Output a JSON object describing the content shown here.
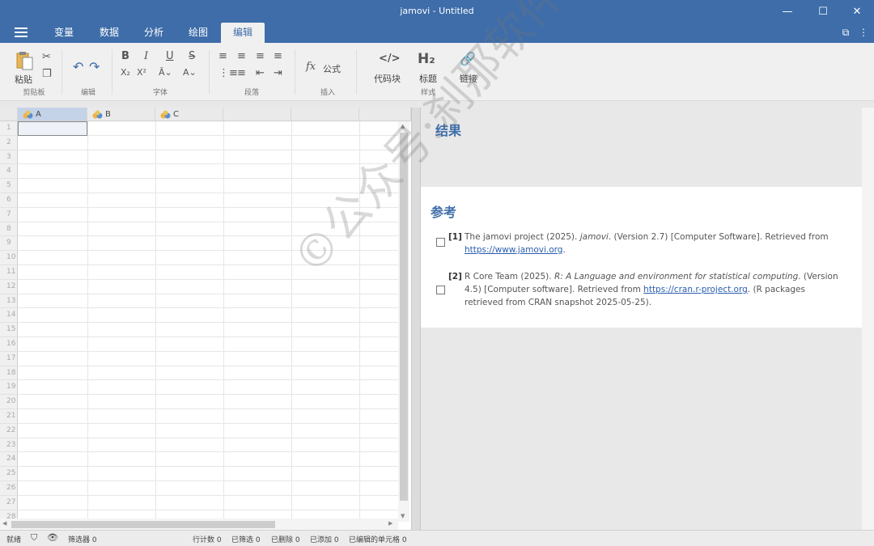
{
  "window": {
    "title": "jamovi - Untitled",
    "minimize": "—",
    "maximize": "☐",
    "close": "✕"
  },
  "tabs": [
    {
      "label": "变量"
    },
    {
      "label": "数据"
    },
    {
      "label": "分析"
    },
    {
      "label": "绘图"
    },
    {
      "label": "编辑"
    }
  ],
  "ribbon": {
    "clipboard": {
      "paste": "粘贴",
      "group": "剪贴板"
    },
    "edit": {
      "group": "编辑"
    },
    "font": {
      "group": "字体"
    },
    "paragraph": {
      "group": "段落"
    },
    "insert": {
      "formula": "公式",
      "group": "插入"
    },
    "style": {
      "code": "代码块",
      "heading": "标题",
      "link": "链接",
      "group": "样式"
    }
  },
  "sheet": {
    "columns": [
      "A",
      "B",
      "C"
    ],
    "rows": [
      "1",
      "2",
      "3",
      "4",
      "5",
      "6",
      "7",
      "8",
      "9",
      "10",
      "11",
      "12",
      "13",
      "14",
      "15",
      "16",
      "17",
      "18",
      "19",
      "20",
      "21",
      "22",
      "23",
      "24",
      "25",
      "26",
      "27",
      "28"
    ]
  },
  "results": {
    "title": "结果",
    "references_title": "参考",
    "refs": [
      {
        "num": "[1]",
        "pre": "The jamovi project (2025). ",
        "em": "jamovi",
        "post": ". (Version 2.7) [Computer Software]. Retrieved from ",
        "link": "https://www.jamovi.org",
        "tail": "."
      },
      {
        "num": "[2]",
        "pre": "R Core Team (2025). ",
        "em": "R: A Language and environment for statistical computing",
        "post": ". (Version 4.5) [Computer software]. Retrieved from ",
        "link": "https://cran.r-project.org",
        "tail": ". (R packages retrieved from CRAN snapshot 2025-05-25)."
      }
    ]
  },
  "status": {
    "ready": "就绪",
    "filters": "筛选器 0",
    "row_count": "行计数 0",
    "filtered": "已筛选 0",
    "deleted": "已删除 0",
    "added": "已添加 0",
    "edited": "已编辑的单元格 0"
  },
  "watermark": "©公众号:刹那软件库",
  "colors": {
    "accent": "#3e6da9"
  }
}
